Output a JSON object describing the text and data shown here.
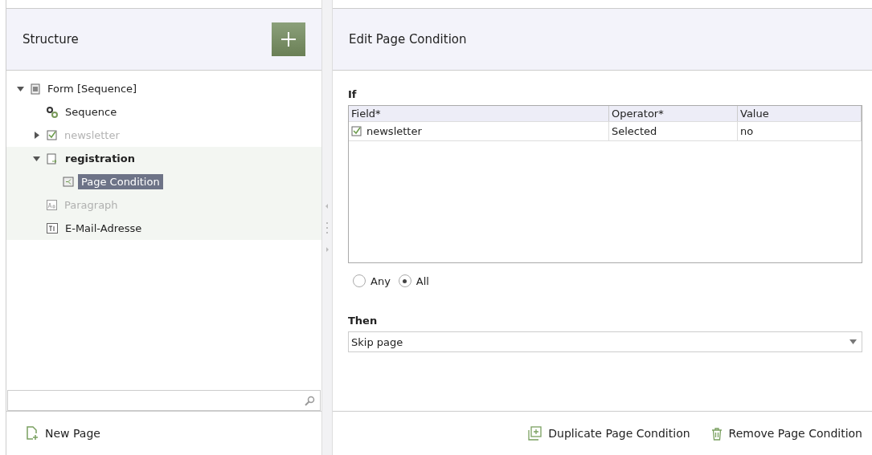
{
  "structure": {
    "title": "Structure",
    "tree": [
      {
        "label": "Form [Sequence]",
        "kind": "form",
        "expanded": true,
        "selected": false,
        "disabled": false,
        "bold": false,
        "highlighted": false,
        "children": [
          {
            "label": "Sequence",
            "kind": "gears",
            "selected": false,
            "disabled": false,
            "bold": false,
            "highlighted": false
          },
          {
            "label": "newsletter",
            "kind": "checkbox",
            "expanded": false,
            "selected": false,
            "disabled": true,
            "bold": false,
            "highlighted": false
          },
          {
            "label": "registration",
            "kind": "page",
            "expanded": true,
            "selected": false,
            "disabled": false,
            "bold": true,
            "highlighted": true,
            "children": [
              {
                "label": "Page Condition",
                "kind": "condition",
                "selected": true,
                "disabled": false,
                "bold": false,
                "highlighted": true
              }
            ]
          },
          {
            "label": "Paragraph",
            "kind": "paragraph",
            "selected": false,
            "disabled": true,
            "bold": false,
            "highlighted": true
          },
          {
            "label": "E-Mail-Adresse",
            "kind": "textfield",
            "selected": false,
            "disabled": false,
            "bold": false,
            "highlighted": true
          }
        ]
      }
    ],
    "footer_button": "New Page"
  },
  "editor": {
    "title": "Edit Page Condition",
    "if_label": "If",
    "table": {
      "columns": [
        "Field*",
        "Operator*",
        "Value"
      ],
      "rows": [
        {
          "field": "newsletter",
          "operator": "Selected",
          "value": "no"
        }
      ]
    },
    "match": [
      {
        "label": "Any",
        "selected": false
      },
      {
        "label": "All",
        "selected": true
      }
    ],
    "then_label": "Then",
    "then_value": "Skip page",
    "buttons": [
      {
        "label": "Duplicate Page Condition",
        "kind": "duplicate"
      },
      {
        "label": "Remove Page Condition",
        "kind": "remove"
      }
    ]
  }
}
